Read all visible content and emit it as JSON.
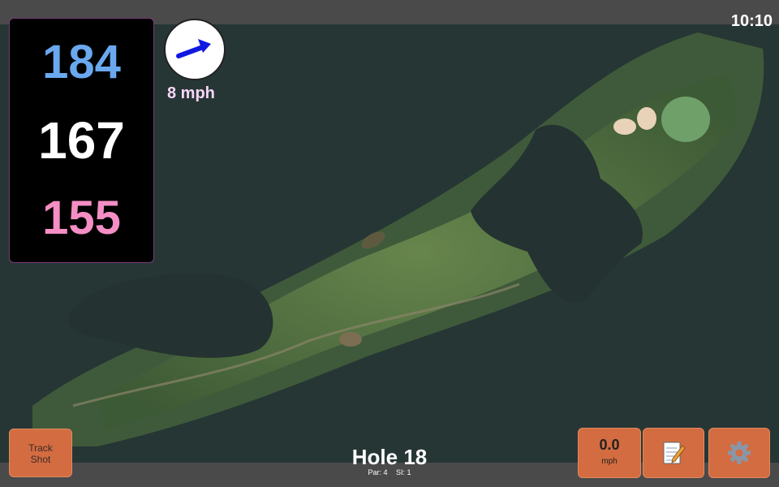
{
  "clock": "10:10",
  "distances": {
    "back": "184",
    "middle": "167",
    "front": "155"
  },
  "wind": {
    "speed": "8 mph",
    "direction_icon": "wind-arrow-icon"
  },
  "track_shot": {
    "line1": "Track",
    "line2": "Shot"
  },
  "speed_readout": {
    "value": "0.0",
    "unit": "mph"
  },
  "notes_button": {
    "icon": "notepad-icon"
  },
  "settings_button": {
    "icon": "gear-icon"
  },
  "hole": {
    "title": "Hole 18",
    "par": "Par: 4",
    "si": "SI: 1"
  },
  "colors": {
    "back_distance": "#6aa8f0",
    "middle_distance": "#ffffff",
    "front_distance": "#f58ec4",
    "button": "#d36c40",
    "wind_text": "#f7d6f7"
  }
}
